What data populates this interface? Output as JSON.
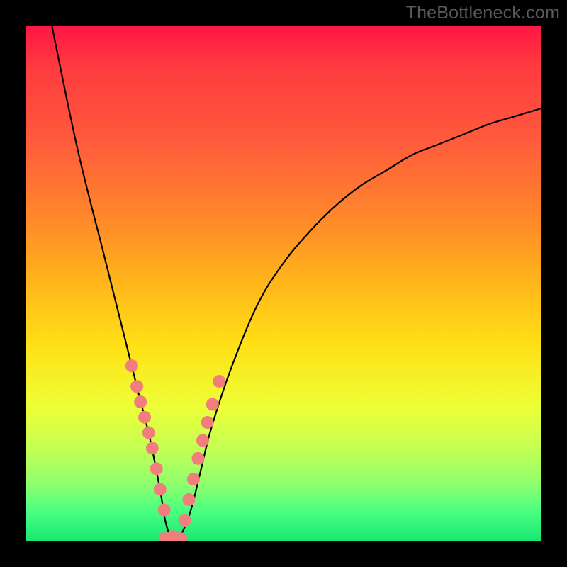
{
  "watermark": "TheBottleneck.com",
  "colors": {
    "curve": "#000000",
    "marker_fill": "#f27d7d",
    "marker_stroke": "#c75f5f",
    "gradient_stops": [
      "#ff1744",
      "#ff3b3f",
      "#ff5a3c",
      "#ff8a2a",
      "#ffb61a",
      "#ffe016",
      "#edff37",
      "#c4ff54",
      "#8fff6e",
      "#4cff80",
      "#18e874"
    ]
  },
  "chart_data": {
    "type": "line",
    "title": "",
    "xlabel": "",
    "ylabel": "",
    "xlim": [
      0,
      100
    ],
    "ylim": [
      0,
      100
    ],
    "note": "V-shaped bottleneck curve over rainbow background. y=0 at bottom (green), y=100 at top (red). Minimum near x≈27–30 where y≈0.",
    "series": [
      {
        "name": "bottleneck-curve",
        "x": [
          5,
          10,
          15,
          18,
          20,
          22,
          24,
          26,
          27,
          28,
          29,
          30,
          32,
          34,
          36,
          40,
          45,
          50,
          55,
          60,
          65,
          70,
          75,
          80,
          85,
          90,
          95,
          100
        ],
        "y": [
          100,
          76,
          56,
          44,
          36,
          28,
          20,
          10,
          4,
          1,
          0.5,
          1,
          6,
          14,
          22,
          34,
          46,
          54,
          60,
          65,
          69,
          72,
          75,
          77,
          79,
          81,
          82.5,
          84
        ]
      }
    ],
    "markers": {
      "name": "highlight-points",
      "note": "Pink dots clustered around the valley (roughly 30%–45% band on y)",
      "x": [
        20.5,
        21.5,
        22.2,
        23.0,
        23.8,
        24.5,
        25.3,
        26.0,
        26.8,
        28.5,
        30.8,
        31.6,
        32.5,
        33.4,
        34.3,
        35.2,
        36.2,
        37.5
      ],
      "y": [
        34,
        30,
        27,
        24,
        21,
        18,
        14,
        10,
        6,
        0.8,
        4,
        8,
        12,
        16,
        19.5,
        23,
        26.5,
        31
      ]
    },
    "bottom_band": {
      "name": "valley-bar",
      "note": "Short thick pink segment at y≈0 spanning approx x 27–30",
      "x0": 26.8,
      "x1": 30.2
    }
  }
}
